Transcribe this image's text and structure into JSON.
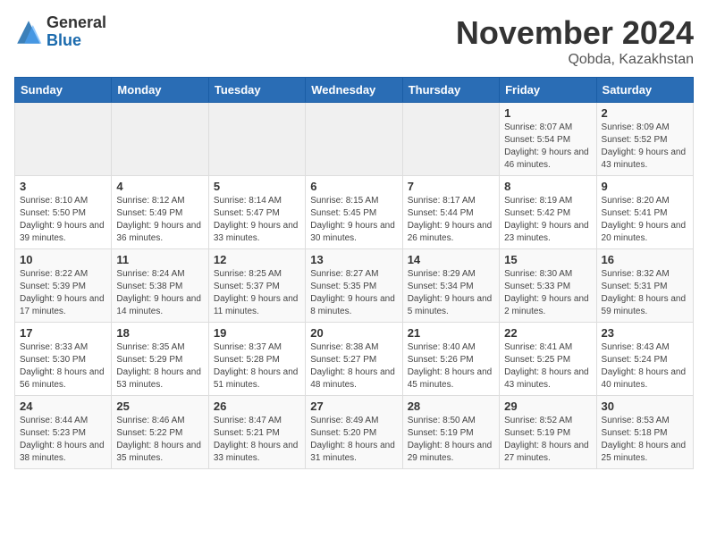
{
  "header": {
    "logo_general": "General",
    "logo_blue": "Blue",
    "month_title": "November 2024",
    "location": "Qobda, Kazakhstan"
  },
  "weekdays": [
    "Sunday",
    "Monday",
    "Tuesday",
    "Wednesday",
    "Thursday",
    "Friday",
    "Saturday"
  ],
  "weeks": [
    [
      {
        "day": "",
        "info": ""
      },
      {
        "day": "",
        "info": ""
      },
      {
        "day": "",
        "info": ""
      },
      {
        "day": "",
        "info": ""
      },
      {
        "day": "",
        "info": ""
      },
      {
        "day": "1",
        "info": "Sunrise: 8:07 AM\nSunset: 5:54 PM\nDaylight: 9 hours\nand 46 minutes."
      },
      {
        "day": "2",
        "info": "Sunrise: 8:09 AM\nSunset: 5:52 PM\nDaylight: 9 hours\nand 43 minutes."
      }
    ],
    [
      {
        "day": "3",
        "info": "Sunrise: 8:10 AM\nSunset: 5:50 PM\nDaylight: 9 hours\nand 39 minutes."
      },
      {
        "day": "4",
        "info": "Sunrise: 8:12 AM\nSunset: 5:49 PM\nDaylight: 9 hours\nand 36 minutes."
      },
      {
        "day": "5",
        "info": "Sunrise: 8:14 AM\nSunset: 5:47 PM\nDaylight: 9 hours\nand 33 minutes."
      },
      {
        "day": "6",
        "info": "Sunrise: 8:15 AM\nSunset: 5:45 PM\nDaylight: 9 hours\nand 30 minutes."
      },
      {
        "day": "7",
        "info": "Sunrise: 8:17 AM\nSunset: 5:44 PM\nDaylight: 9 hours\nand 26 minutes."
      },
      {
        "day": "8",
        "info": "Sunrise: 8:19 AM\nSunset: 5:42 PM\nDaylight: 9 hours\nand 23 minutes."
      },
      {
        "day": "9",
        "info": "Sunrise: 8:20 AM\nSunset: 5:41 PM\nDaylight: 9 hours\nand 20 minutes."
      }
    ],
    [
      {
        "day": "10",
        "info": "Sunrise: 8:22 AM\nSunset: 5:39 PM\nDaylight: 9 hours\nand 17 minutes."
      },
      {
        "day": "11",
        "info": "Sunrise: 8:24 AM\nSunset: 5:38 PM\nDaylight: 9 hours\nand 14 minutes."
      },
      {
        "day": "12",
        "info": "Sunrise: 8:25 AM\nSunset: 5:37 PM\nDaylight: 9 hours\nand 11 minutes."
      },
      {
        "day": "13",
        "info": "Sunrise: 8:27 AM\nSunset: 5:35 PM\nDaylight: 9 hours\nand 8 minutes."
      },
      {
        "day": "14",
        "info": "Sunrise: 8:29 AM\nSunset: 5:34 PM\nDaylight: 9 hours\nand 5 minutes."
      },
      {
        "day": "15",
        "info": "Sunrise: 8:30 AM\nSunset: 5:33 PM\nDaylight: 9 hours\nand 2 minutes."
      },
      {
        "day": "16",
        "info": "Sunrise: 8:32 AM\nSunset: 5:31 PM\nDaylight: 8 hours\nand 59 minutes."
      }
    ],
    [
      {
        "day": "17",
        "info": "Sunrise: 8:33 AM\nSunset: 5:30 PM\nDaylight: 8 hours\nand 56 minutes."
      },
      {
        "day": "18",
        "info": "Sunrise: 8:35 AM\nSunset: 5:29 PM\nDaylight: 8 hours\nand 53 minutes."
      },
      {
        "day": "19",
        "info": "Sunrise: 8:37 AM\nSunset: 5:28 PM\nDaylight: 8 hours\nand 51 minutes."
      },
      {
        "day": "20",
        "info": "Sunrise: 8:38 AM\nSunset: 5:27 PM\nDaylight: 8 hours\nand 48 minutes."
      },
      {
        "day": "21",
        "info": "Sunrise: 8:40 AM\nSunset: 5:26 PM\nDaylight: 8 hours\nand 45 minutes."
      },
      {
        "day": "22",
        "info": "Sunrise: 8:41 AM\nSunset: 5:25 PM\nDaylight: 8 hours\nand 43 minutes."
      },
      {
        "day": "23",
        "info": "Sunrise: 8:43 AM\nSunset: 5:24 PM\nDaylight: 8 hours\nand 40 minutes."
      }
    ],
    [
      {
        "day": "24",
        "info": "Sunrise: 8:44 AM\nSunset: 5:23 PM\nDaylight: 8 hours\nand 38 minutes."
      },
      {
        "day": "25",
        "info": "Sunrise: 8:46 AM\nSunset: 5:22 PM\nDaylight: 8 hours\nand 35 minutes."
      },
      {
        "day": "26",
        "info": "Sunrise: 8:47 AM\nSunset: 5:21 PM\nDaylight: 8 hours\nand 33 minutes."
      },
      {
        "day": "27",
        "info": "Sunrise: 8:49 AM\nSunset: 5:20 PM\nDaylight: 8 hours\nand 31 minutes."
      },
      {
        "day": "28",
        "info": "Sunrise: 8:50 AM\nSunset: 5:19 PM\nDaylight: 8 hours\nand 29 minutes."
      },
      {
        "day": "29",
        "info": "Sunrise: 8:52 AM\nSunset: 5:19 PM\nDaylight: 8 hours\nand 27 minutes."
      },
      {
        "day": "30",
        "info": "Sunrise: 8:53 AM\nSunset: 5:18 PM\nDaylight: 8 hours\nand 25 minutes."
      }
    ]
  ]
}
